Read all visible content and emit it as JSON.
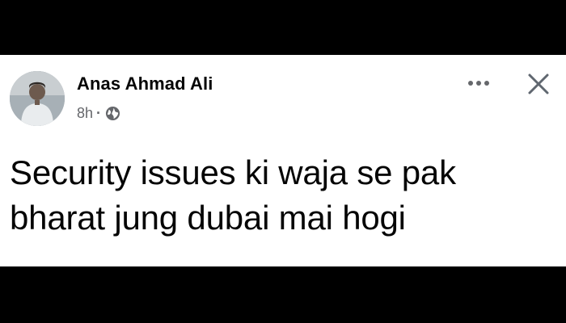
{
  "post": {
    "author": "Anas Ahmad Ali",
    "time": "8h",
    "separator": "·",
    "privacy_icon": "globe-icon",
    "text_line1": "Security issues ki waja se pak",
    "text_line2": "bharat jung dubai mai hogi"
  },
  "actions": {
    "more_icon": "more-options-icon",
    "close_icon": "close-icon"
  },
  "colors": {
    "background": "#ffffff",
    "text": "#050505",
    "secondary_text": "#65676b",
    "frame": "#000000"
  }
}
